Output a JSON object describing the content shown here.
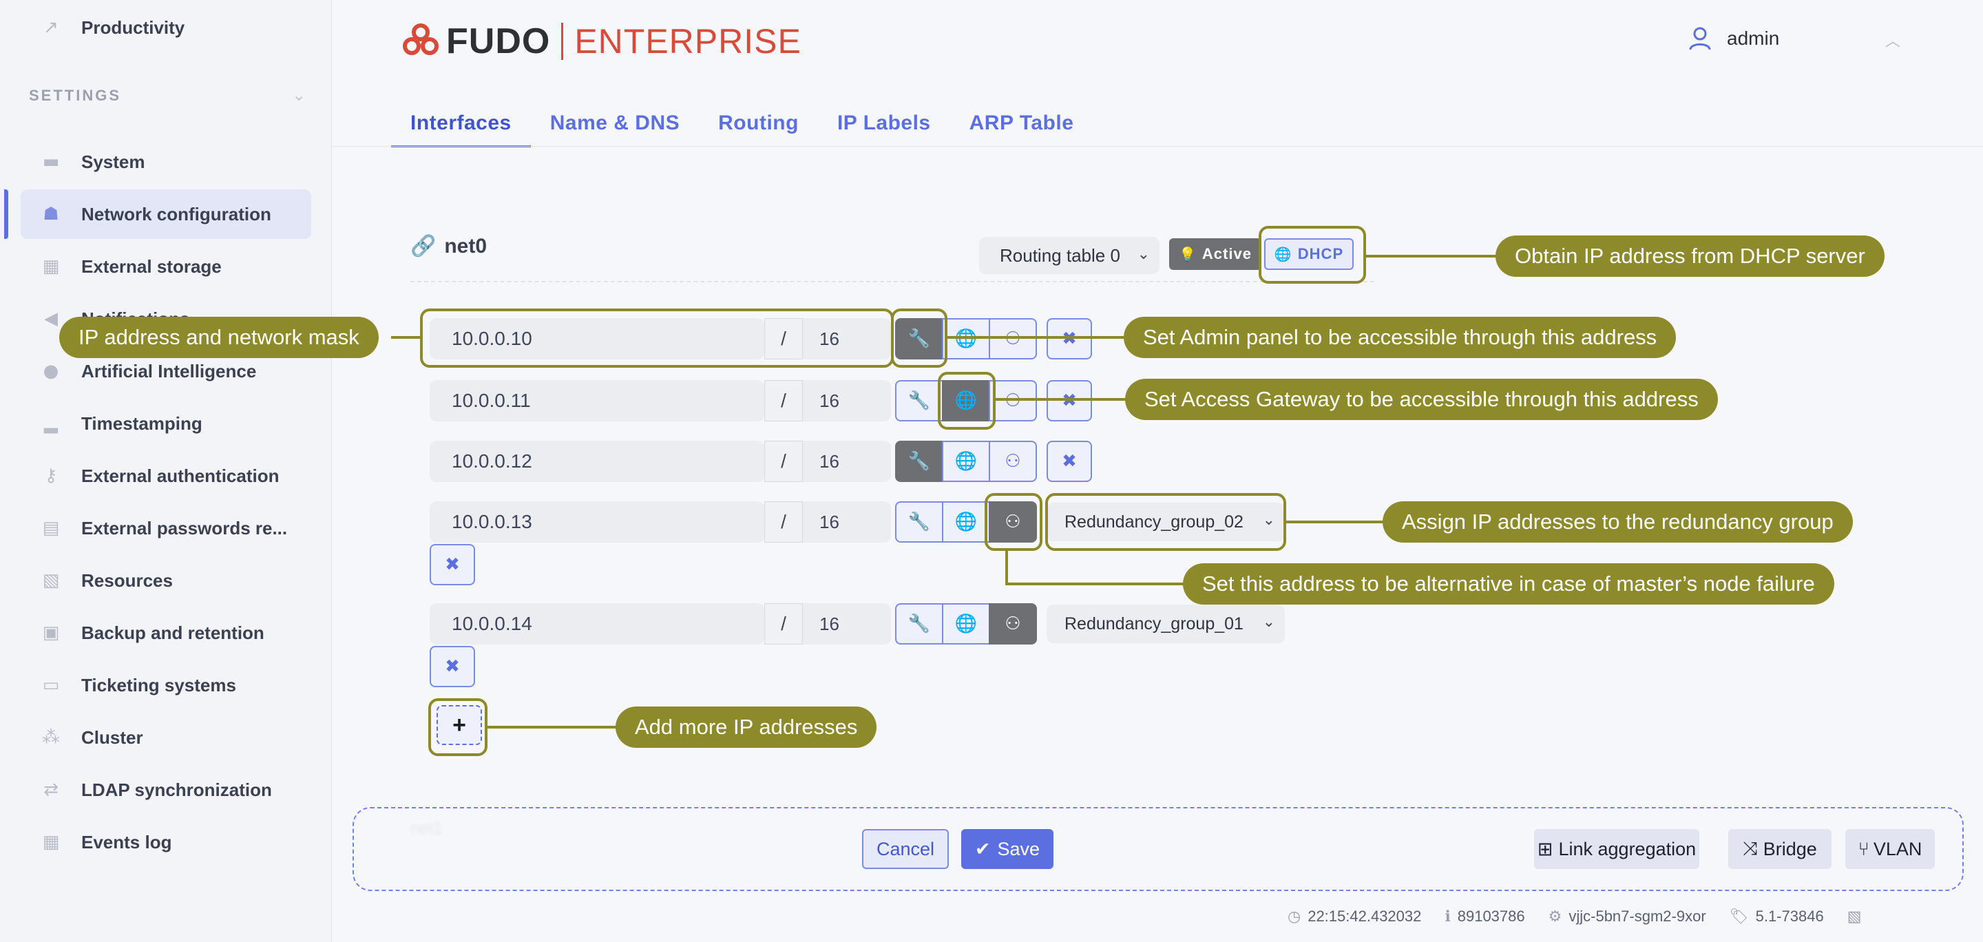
{
  "sidebar": {
    "top_item": {
      "label": "Productivity",
      "icon": "chart-line-icon"
    },
    "settings_header": "SETTINGS",
    "items": [
      {
        "label": "System",
        "icon": "folder-icon",
        "active": false
      },
      {
        "label": "Network configuration",
        "icon": "network-icon",
        "active": true
      },
      {
        "label": "External storage",
        "icon": "storage-icon",
        "active": false
      },
      {
        "label": "Notifications",
        "icon": "megaphone-icon",
        "active": false
      },
      {
        "label": "Artificial Intelligence",
        "icon": "brain-icon",
        "active": false
      },
      {
        "label": "Timestamping",
        "icon": "stamp-icon",
        "active": false
      },
      {
        "label": "External authentication",
        "icon": "key-icon",
        "active": false
      },
      {
        "label": "External passwords re...",
        "icon": "book-icon",
        "active": false
      },
      {
        "label": "Resources",
        "icon": "image-icon",
        "active": false
      },
      {
        "label": "Backup and retention",
        "icon": "archive-icon",
        "active": false
      },
      {
        "label": "Ticketing systems",
        "icon": "ticket-icon",
        "active": false
      },
      {
        "label": "Cluster",
        "icon": "cluster-icon",
        "active": false
      },
      {
        "label": "LDAP synchronization",
        "icon": "sync-icon",
        "active": false
      },
      {
        "label": "Events log",
        "icon": "calendar-icon",
        "active": false
      }
    ]
  },
  "header": {
    "logo_brand": "FUDO",
    "logo_edition": "ENTERPRISE",
    "user_name": "admin"
  },
  "tabs": [
    {
      "label": "Interfaces",
      "active": true
    },
    {
      "label": "Name & DNS",
      "active": false
    },
    {
      "label": "Routing",
      "active": false
    },
    {
      "label": "IP Labels",
      "active": false
    },
    {
      "label": "ARP Table",
      "active": false
    }
  ],
  "interface": {
    "name": "net0",
    "routing_table": "Routing table 0",
    "active_label": "Active",
    "dhcp_label": "DHCP",
    "addresses": [
      {
        "ip": "10.0.0.10",
        "slash": "/",
        "mask": "16",
        "admin": true,
        "gateway": false,
        "redundancy": false,
        "group": ""
      },
      {
        "ip": "10.0.0.11",
        "slash": "/",
        "mask": "16",
        "admin": false,
        "gateway": true,
        "redundancy": false,
        "group": ""
      },
      {
        "ip": "10.0.0.12",
        "slash": "/",
        "mask": "16",
        "admin": true,
        "gateway": false,
        "redundancy": false,
        "group": ""
      },
      {
        "ip": "10.0.0.13",
        "slash": "/",
        "mask": "16",
        "admin": false,
        "gateway": false,
        "redundancy": true,
        "group": "Redundancy_group_02"
      },
      {
        "ip": "10.0.0.14",
        "slash": "/",
        "mask": "16",
        "admin": false,
        "gateway": false,
        "redundancy": true,
        "group": "Redundancy_group_01"
      }
    ],
    "delete_glyph": "✖",
    "add_glyph": "+"
  },
  "annotations": {
    "dhcp": "Obtain IP address from DHCP server",
    "ip_mask": "IP address and network mask",
    "admin": "Set Admin panel to be accessible through this address",
    "gateway": "Set Access Gateway to be accessible through this address",
    "group": "Assign IP addresses to the redundancy group",
    "alternative": "Set this address to be alternative in case of master’s node failure",
    "add": "Add more IP addresses"
  },
  "footer": {
    "ghost_name": "net1",
    "cancel": "Cancel",
    "save": "Save",
    "link_aggregation": "Link aggregation",
    "bridge": "Bridge",
    "vlan": "VLAN"
  },
  "status": {
    "time": "22:15:42.432032",
    "id": "89103786",
    "node": "vjjc-5bn7-sgm2-9xor",
    "version": "5.1-73846"
  },
  "colors": {
    "accent": "#5b6fe0",
    "annotation": "#8c8a2a",
    "brand_red": "#d84a3a",
    "toggle_on": "#6e6f73"
  }
}
